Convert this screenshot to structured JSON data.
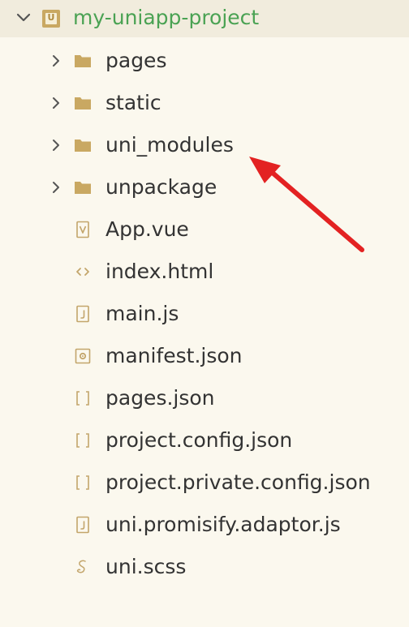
{
  "explorer": {
    "root": {
      "label": "my-uniapp-project",
      "expanded": true,
      "icon": "uniapp-project-icon"
    },
    "items": [
      {
        "label": "pages",
        "type": "folder",
        "icon": "folder-icon",
        "name": "pages"
      },
      {
        "label": "static",
        "type": "folder",
        "icon": "folder-icon",
        "name": "static"
      },
      {
        "label": "uni_modules",
        "type": "folder",
        "icon": "folder-icon",
        "name": "uni-modules"
      },
      {
        "label": "unpackage",
        "type": "folder",
        "icon": "folder-icon",
        "name": "unpackage"
      },
      {
        "label": "App.vue",
        "type": "vue",
        "icon": "vue-file-icon",
        "name": "app-vue"
      },
      {
        "label": "index.html",
        "type": "html",
        "icon": "html-file-icon",
        "name": "index-html"
      },
      {
        "label": "main.js",
        "type": "js",
        "icon": "js-file-icon",
        "name": "main-js"
      },
      {
        "label": "manifest.json",
        "type": "manifest",
        "icon": "manifest-file-icon",
        "name": "manifest-json"
      },
      {
        "label": "pages.json",
        "type": "json",
        "icon": "json-file-icon",
        "name": "pages-json"
      },
      {
        "label": "project.config.json",
        "type": "json",
        "icon": "json-file-icon",
        "name": "project-config-json"
      },
      {
        "label": "project.private.config.json",
        "type": "json",
        "icon": "json-file-icon",
        "name": "project-private-config-json"
      },
      {
        "label": "uni.promisify.adaptor.js",
        "type": "js",
        "icon": "js-file-icon",
        "name": "uni-promisify-adaptor-js"
      },
      {
        "label": "uni.scss",
        "type": "scss",
        "icon": "scss-file-icon",
        "name": "uni-scss"
      }
    ]
  },
  "annotation": {
    "icon": "red-arrow-annotation",
    "color": "#e32222",
    "points_to": "uni_modules"
  },
  "colors": {
    "background": "#fbf8ee",
    "root_row": "#f1ecdd",
    "root_label": "#4aa253",
    "text": "#333333",
    "folder": "#c9a862",
    "file_icon": "#c3a56b"
  }
}
